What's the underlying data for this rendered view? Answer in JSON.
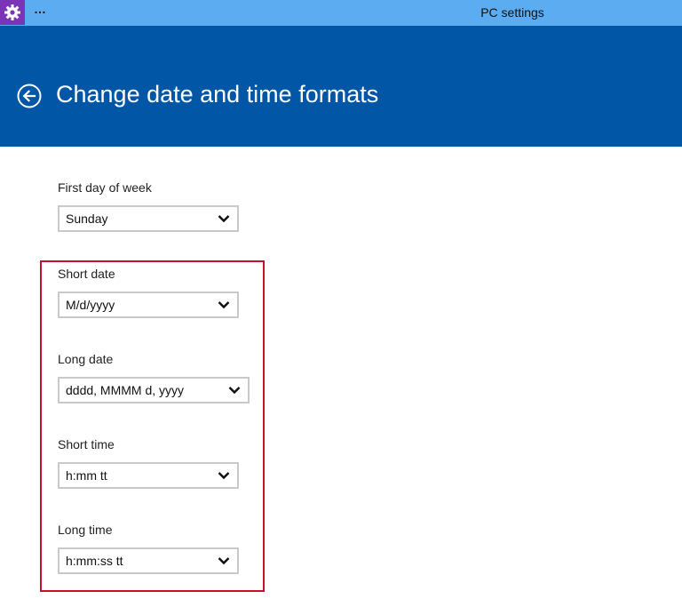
{
  "window": {
    "title": "PC settings",
    "menu_dots": "…"
  },
  "icons": {
    "app": "gear-icon",
    "back": "back-arrow-circle-icon",
    "dropdown": "chevron-down-icon"
  },
  "colors": {
    "titlebar": "#5cacf2",
    "header": "#0156a6",
    "app_icon_bg": "#7b33b8",
    "highlight": "#c8102e"
  },
  "header": {
    "title": "Change date and time formats"
  },
  "settings": {
    "first_day_of_week": {
      "label": "First day of week",
      "value": "Sunday"
    },
    "short_date": {
      "label": "Short date",
      "value": "M/d/yyyy"
    },
    "long_date": {
      "label": "Long date",
      "value": "dddd, MMMM d, yyyy"
    },
    "short_time": {
      "label": "Short time",
      "value": "h:mm tt"
    },
    "long_time": {
      "label": "Long time",
      "value": "h:mm:ss tt"
    }
  }
}
